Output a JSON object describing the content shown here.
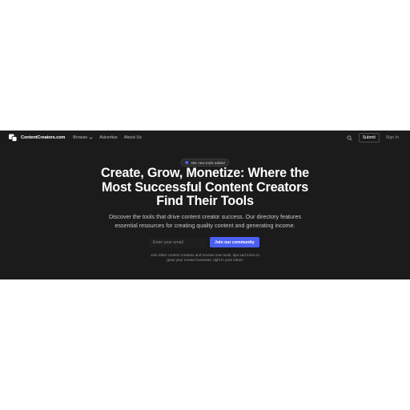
{
  "nav": {
    "brand_name": "ContentCreators.com",
    "links": {
      "browse": "Browse",
      "advertise": "Advertise",
      "about": "About Us"
    },
    "submit_label": "Submit",
    "signin_label": "Sign In"
  },
  "hero": {
    "badge_text": "491 new tools added",
    "title_lines": [
      "Create, Grow, Monetize: Where the",
      "Most Successful Content Creators",
      "Find Their Tools"
    ],
    "subtitle_lines": [
      "Discover the tools that drive content creator success. Our directory features",
      "essential resources for creating quality content and generating income."
    ]
  },
  "signup": {
    "email_placeholder": "Enter your email",
    "email_value": "",
    "button_label": "Join our community",
    "note_lines": [
      "Join other content creators and receive new tools, tips and tricks to",
      "grow your creator business, right in your inbox!"
    ]
  },
  "colors": {
    "background": "#1b1b1b",
    "accent": "#4c5ff5",
    "text": "#ffffff",
    "muted": "#c8c8c8"
  },
  "icons": {
    "brand": "brand-logo-icon",
    "browse": "chevron-down-icon",
    "search": "search-icon",
    "badge": "status-dot-icon"
  }
}
